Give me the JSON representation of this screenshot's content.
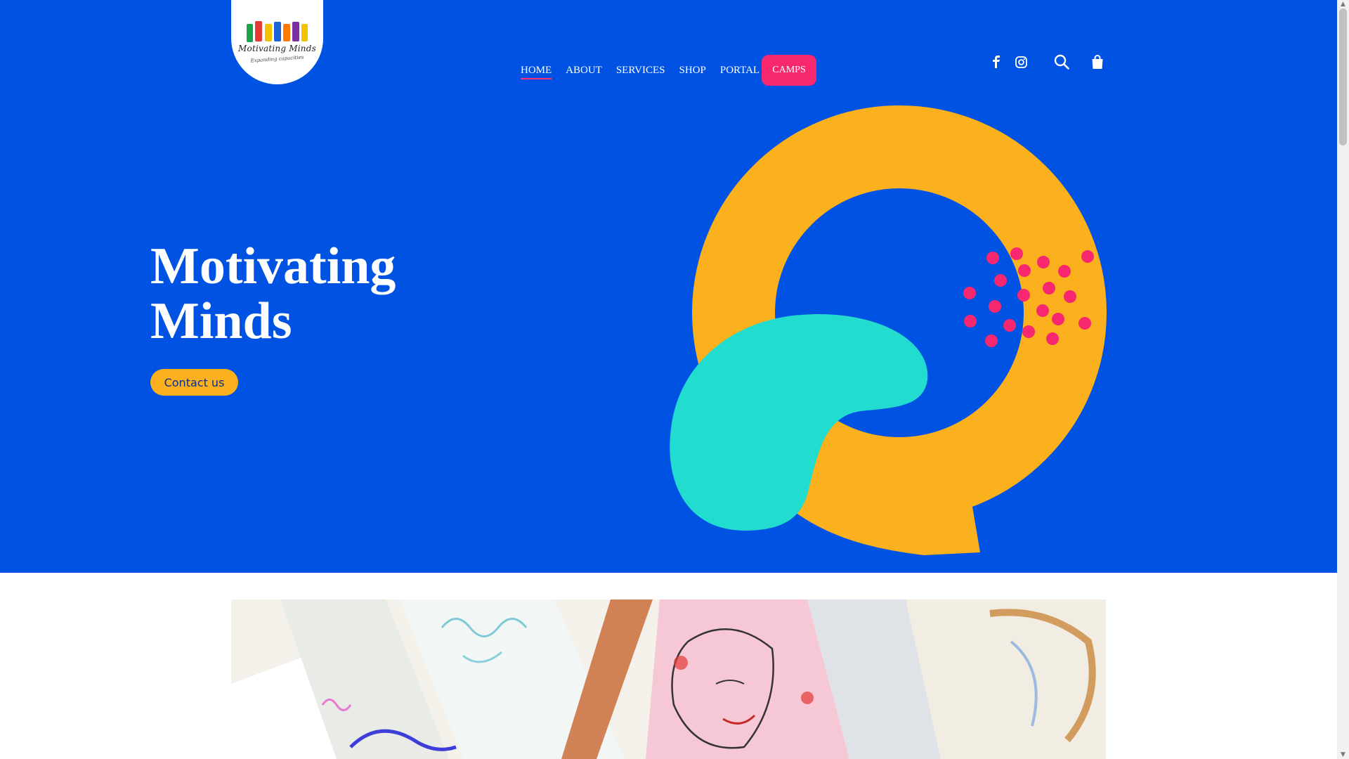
{
  "brand": {
    "logo_text": "Motivating Minds",
    "logo_tagline": "Expanding capacities",
    "logo_colors": [
      "#1aa34a",
      "#e53935",
      "#f2c200",
      "#1e63d6",
      "#7b2fa0",
      "#ff7a00"
    ]
  },
  "nav": {
    "items": [
      {
        "label": "HOME",
        "active": true
      },
      {
        "label": "ABOUT",
        "active": false
      },
      {
        "label": "SERVICES",
        "active": false
      },
      {
        "label": "SHOP",
        "active": false
      },
      {
        "label": "PORTAL",
        "active": false
      }
    ],
    "cta_label": "CAMPS"
  },
  "header_icons": [
    "facebook-icon",
    "instagram-icon",
    "search-icon",
    "shopping-bag-icon"
  ],
  "hero": {
    "title_line1": "Motivating",
    "title_line2": "Minds",
    "button_label": "Contact us"
  },
  "colors": {
    "hero_bg": "#0053e2",
    "accent_pink": "#f7286f",
    "accent_yellow": "#fbb01d",
    "accent_teal": "#22dccf",
    "white": "#ffffff"
  }
}
